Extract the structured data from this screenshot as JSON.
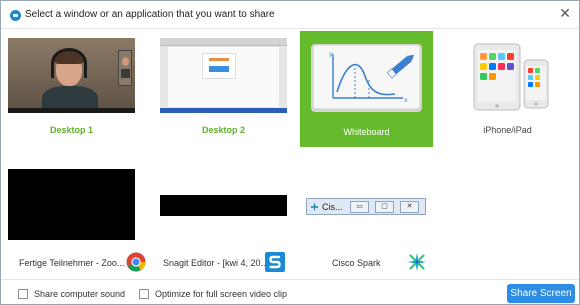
{
  "titlebar": {
    "title": "Select a window or an application that you want to share",
    "close_glyph": "✕"
  },
  "tiles": {
    "desktop1": {
      "label": "Desktop 1"
    },
    "desktop2": {
      "label": "Desktop 2"
    },
    "whiteboard": {
      "label": "Whiteboard",
      "selected": true
    },
    "iphone": {
      "label": "iPhone/iPad"
    },
    "app1": {
      "label": "Fertige Teilnehmer - Zoo...",
      "icon": "chrome-icon"
    },
    "app2": {
      "label": "Snagit Editor - [kwi 4, 20...",
      "icon": "snagit-icon"
    },
    "app3": {
      "label": "Cisco Spark",
      "icon": "cisco-spark-icon",
      "window_title": "Cis..."
    }
  },
  "footer": {
    "share_sound_label": "Share computer sound",
    "optimize_label": "Optimize for full screen video clip",
    "share_button": "Share Screen"
  },
  "colors": {
    "selected": "#66bb2c",
    "green_text": "#5fb02c",
    "share_button": "#2d8ce3"
  }
}
